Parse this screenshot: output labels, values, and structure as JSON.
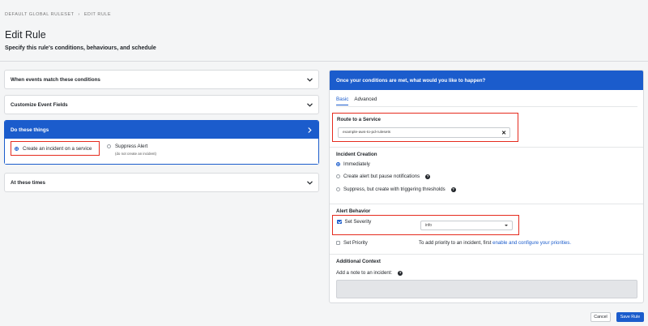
{
  "breadcrumb": {
    "items": [
      "DEFAULT GLOBAL RULESET",
      "›",
      "EDIT RULE"
    ]
  },
  "header": {
    "title": "Edit Rule",
    "subtitle": "Specify this rule's conditions, behaviours, and schedule"
  },
  "left": {
    "sections": [
      {
        "label": "When events match these conditions"
      },
      {
        "label": "Customize Event Fields"
      },
      {
        "label": "Do these things"
      },
      {
        "label": "At these times"
      }
    ],
    "actions": {
      "option1": "Create an incident on a service",
      "option2": "Suppress Alert",
      "option2_note": "(do not create an incident)"
    }
  },
  "right": {
    "header": "Once your conditions are met, what would you like to happen?",
    "tabs": [
      "Basic",
      "Advanced"
    ],
    "route": {
      "title": "Route to a Service",
      "value": "example-aws-to-pd-rulesets"
    },
    "incident": {
      "title": "Incident Creation",
      "options": [
        "Immediately",
        "Create alert but pause notifications",
        "Suppress, but create with triggering thresholds"
      ]
    },
    "alert": {
      "title": "Alert Behavior",
      "severity_label": "Set Severity",
      "severity_value": "info",
      "priority_label": "Set Priority",
      "priority_note": "To add priority to an incident, first",
      "priority_link": "enable and configure your priorities."
    },
    "context": {
      "title": "Additional Context",
      "note_label": "Add a note to an incident:"
    }
  },
  "footer": {
    "cancel": "Cancel",
    "save": "Save Rule"
  },
  "colors": {
    "accent": "#1b5ccc",
    "highlight": "#e52b1e"
  }
}
